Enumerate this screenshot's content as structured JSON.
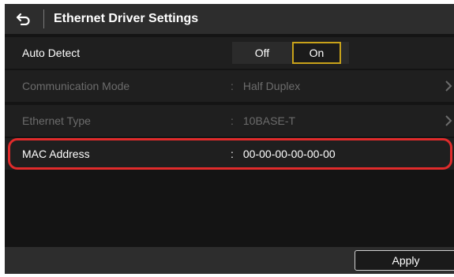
{
  "header": {
    "back_icon": "back-arrow-icon",
    "title": "Ethernet Driver Settings"
  },
  "auto_detect": {
    "label": "Auto Detect",
    "options": [
      "Off",
      "On"
    ],
    "selected": "On"
  },
  "communication_mode": {
    "label": "Communication Mode",
    "value": "Half Duplex",
    "enabled": false
  },
  "ethernet_type": {
    "label": "Ethernet Type",
    "value": "10BASE-T",
    "enabled": false
  },
  "mac_address": {
    "label": "MAC Address",
    "value": "00-00-00-00-00-00"
  },
  "footer": {
    "apply_label": "Apply"
  },
  "colors": {
    "highlight": "#e02b2b",
    "selected_toggle": "#c8a21a",
    "disabled_text": "#6c6c6c"
  }
}
